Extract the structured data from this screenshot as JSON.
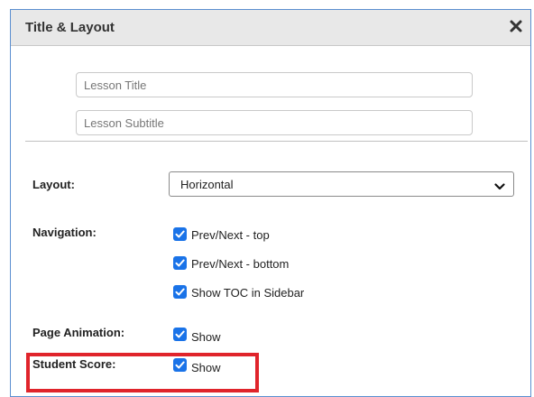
{
  "dialog": {
    "title": "Title & Layout",
    "close_icon": "close-icon"
  },
  "fields": {
    "lesson_title": {
      "placeholder": "Lesson Title",
      "value": ""
    },
    "lesson_subtitle": {
      "placeholder": "Lesson Subtitle",
      "value": ""
    }
  },
  "layout": {
    "label": "Layout:",
    "selected": "Horizontal"
  },
  "navigation": {
    "label": "Navigation:",
    "options": [
      {
        "label": "Prev/Next - top",
        "checked": true
      },
      {
        "label": "Prev/Next - bottom",
        "checked": true
      },
      {
        "label": "Show TOC in Sidebar",
        "checked": true
      }
    ]
  },
  "page_animation": {
    "label": "Page Animation:",
    "option": {
      "label": "Show",
      "checked": true
    }
  },
  "student_score": {
    "label": "Student Score:",
    "option": {
      "label": "Show",
      "checked": true
    }
  },
  "colors": {
    "checkbox": "#1a73e8",
    "highlight": "#e0242b",
    "dialog_border": "#5b8fd0"
  }
}
